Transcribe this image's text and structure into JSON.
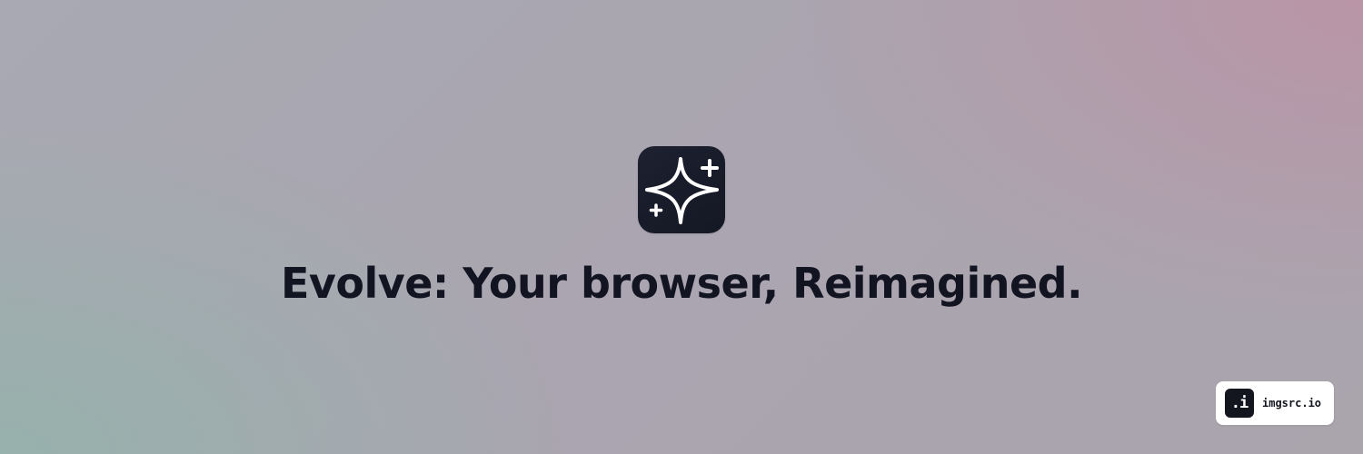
{
  "hero": {
    "icon": "sparkles-icon",
    "headline": "Evolve: Your browser, Reimagined."
  },
  "badge": {
    "logo_text": ".i",
    "label": "imgsrc.io"
  },
  "colors": {
    "icon_background": "#1a1e2b",
    "headline_text": "#121521",
    "badge_background": "#ffffff"
  }
}
